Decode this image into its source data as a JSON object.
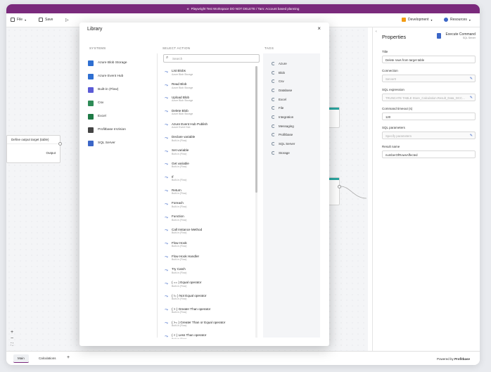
{
  "titlebar": {
    "text": "Playwright Test Workspace DO NOT DELETE / Tam: Account based planning"
  },
  "toolbar": {
    "file": "File",
    "save": "Save",
    "environment": "Development",
    "resources": "Resources"
  },
  "canvas": {
    "node1_title": "Define output target (table)",
    "node1_output": "Output",
    "zoom_in": "+",
    "zoom_out": "−",
    "fit": "⛶"
  },
  "bottombar": {
    "tabs": [
      "Main",
      "Calculations"
    ],
    "add": "+",
    "powered": "Powered by",
    "brand": "Profitbase"
  },
  "properties": {
    "title": "Properties",
    "command_name": "Execute Command",
    "command_type": "SQL Server",
    "fields": [
      {
        "label": "Title",
        "value": "Delete rows from target table",
        "disabled": false,
        "edit": false
      },
      {
        "label": "Connection",
        "value": "Server0",
        "disabled": true,
        "edit": true
      },
      {
        "label": "SQL expression",
        "value": "TRUNCATE TABLE Store_Calculation.Result_Data_DCC...",
        "disabled": true,
        "edit": true
      },
      {
        "label": "Command timeout (s)",
        "value": "120",
        "disabled": false,
        "edit": false
      },
      {
        "label": "SQL parameters",
        "value": "Specify parameters",
        "disabled": true,
        "edit": true
      },
      {
        "label": "Result name",
        "value": "numberOfRowsAffected",
        "disabled": false,
        "edit": false
      }
    ]
  },
  "library": {
    "title": "Library",
    "close": "×",
    "systems_header": "SYSTEMS",
    "actions_header": "SELECT ACTION",
    "tags_header": "TAGS",
    "search_placeholder": "Search",
    "systems": [
      {
        "label": "Azure Blob Storage",
        "color": "#2f6fd1"
      },
      {
        "label": "Azure Event Hub",
        "color": "#2f6fd1"
      },
      {
        "label": "Built-in (Flow)",
        "color": "#5b5bd6"
      },
      {
        "label": "Csv",
        "color": "#2e8b57"
      },
      {
        "label": "Excel",
        "color": "#1e7a45"
      },
      {
        "label": "Profitbase InVision",
        "color": "#444444"
      },
      {
        "label": "SQL Server",
        "color": "#3b66c7"
      }
    ],
    "actions": [
      {
        "name": "List Blobs",
        "sub": "Azure Blob Storage"
      },
      {
        "name": "Read Blob",
        "sub": "Azure Blob Storage"
      },
      {
        "name": "Upload Blob",
        "sub": "Azure Blob Storage"
      },
      {
        "name": "Delete Blob",
        "sub": "Azure Blob Storage"
      },
      {
        "name": "Azure Event Hub Publish",
        "sub": "Azure Event Hub"
      },
      {
        "name": "Declare variable",
        "sub": "Built-in (Flow)"
      },
      {
        "name": "Set variable",
        "sub": "Built-in (Flow)"
      },
      {
        "name": "Get variable",
        "sub": "Built-in (Flow)"
      },
      {
        "name": "If",
        "sub": "Built-in (Flow)"
      },
      {
        "name": "Return",
        "sub": "Built-in (Flow)"
      },
      {
        "name": "Foreach",
        "sub": "Built-in (Flow)"
      },
      {
        "name": "Function",
        "sub": "Built-in (Flow)"
      },
      {
        "name": "Call Instance Method",
        "sub": "Built-in (Flow)"
      },
      {
        "name": "Flow Hook",
        "sub": "Built-in (Flow)"
      },
      {
        "name": "Flow Hook Handler",
        "sub": "Built-in (Flow)"
      },
      {
        "name": "Try Catch",
        "sub": "Built-in (Flow)"
      },
      {
        "name": "( == ) Equal operator",
        "sub": "Built-in (Flow)"
      },
      {
        "name": "( != ) Not Equal operator",
        "sub": "Built-in (Flow)"
      },
      {
        "name": "( > ) Greater Than operator",
        "sub": "Built-in (Flow)"
      },
      {
        "name": "( >= ) Greater Than or Equal operator",
        "sub": "Built-in (Flow)"
      },
      {
        "name": "( < ) Less Than operator",
        "sub": "Built-in (Flow)"
      }
    ],
    "tags": [
      "Azure",
      "Blob",
      "Csv",
      "Database",
      "Excel",
      "File",
      "Integration",
      "Messaging",
      "Profitbase",
      "SQL Server",
      "Storage"
    ]
  },
  "colors": {
    "brand": "#7a2a7c",
    "accent": "#2aa6a1",
    "link": "#3b66c7"
  }
}
